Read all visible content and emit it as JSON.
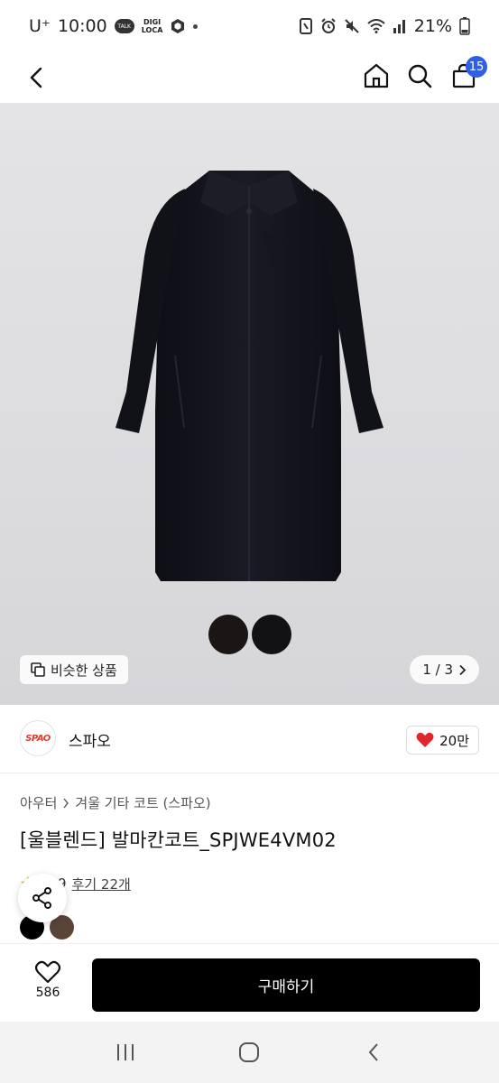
{
  "status_bar": {
    "carrier": "U⁺",
    "time": "10:00",
    "talk_label": "TALK",
    "digi_label_top": "DIGI",
    "digi_label_bottom": "LOCA",
    "battery": "21%"
  },
  "header": {
    "cart_count": "15"
  },
  "gallery": {
    "similar_label": "비슷한 상품",
    "page_indicator": "1 / 3",
    "swatch_colors": [
      "#1b1616",
      "#121214"
    ]
  },
  "brand": {
    "logo_text": "SPAO",
    "name": "스파오",
    "likes": "20만"
  },
  "product": {
    "breadcrumb": [
      "아우터",
      "겨울 기타 코트 (스파오)"
    ],
    "title": "[울블렌드] 발마칸코트_SPJWE4VM02",
    "rating_partial": "9",
    "reviews_label": "후기 22개",
    "colors": [
      "#000000",
      "#5a4438"
    ]
  },
  "bottom_bar": {
    "wishlist_count": "586",
    "buy_label": "구매하기"
  },
  "colors": {
    "accent": "#2f5fe3",
    "heart": "#e0262b",
    "brand_red": "#e23b2e"
  }
}
